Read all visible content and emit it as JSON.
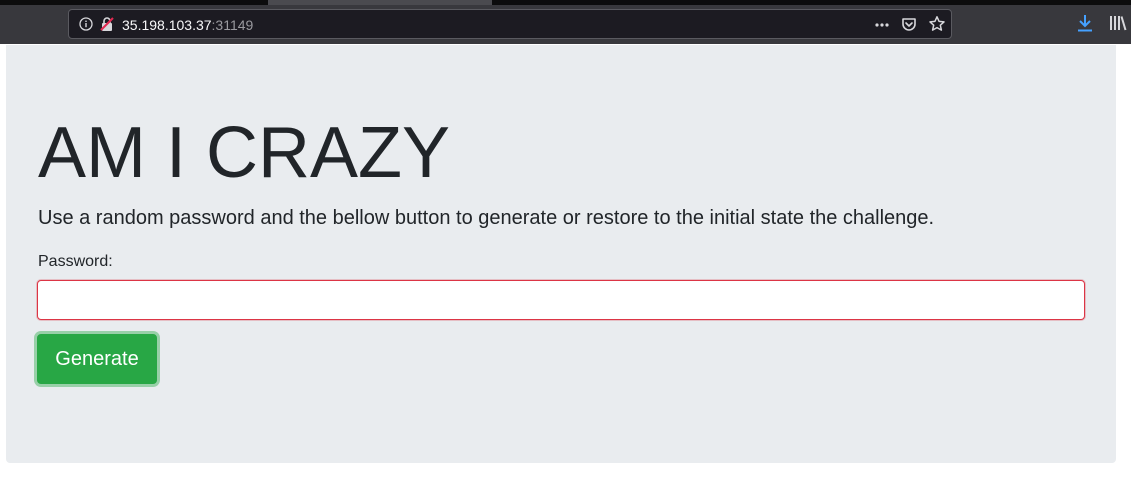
{
  "browser": {
    "url_host": "35.198.103.37",
    "url_port": ":31149"
  },
  "page": {
    "title": "AM I CRAZY",
    "lead": "Use a random password and the bellow button to generate or restore to the initial state the challenge.",
    "password_label": "Password:",
    "password_value": "",
    "generate_label": "Generate"
  },
  "icons": {
    "info": "info-icon",
    "insecure": "insecure-connection-icon",
    "more": "more-icon",
    "pocket": "pocket-icon",
    "bookmark": "bookmark-star-icon",
    "download": "download-icon",
    "library": "library-icon"
  },
  "colors": {
    "accent_download": "#45a1ff",
    "button_green": "#28a745",
    "invalid_border": "#dc3545",
    "jumbotron_bg": "#e9ecef"
  }
}
